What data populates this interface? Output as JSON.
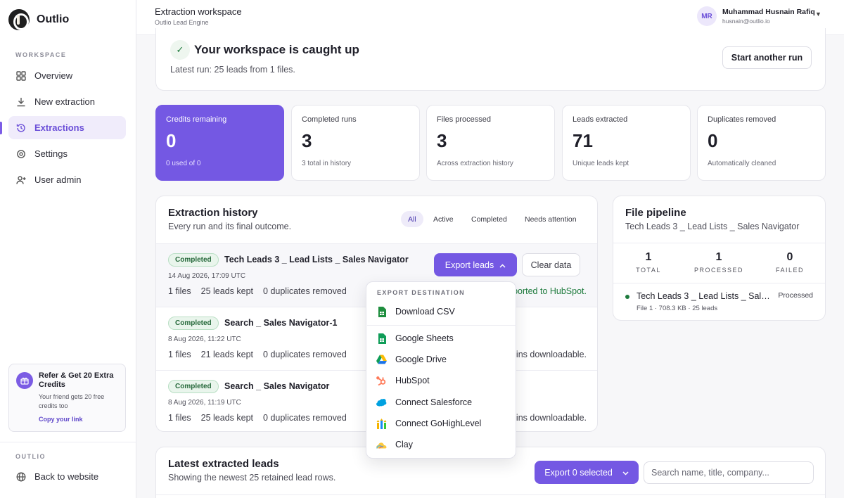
{
  "brand": {
    "name": "Outlio"
  },
  "sidebar": {
    "section_workspace": "WORKSPACE",
    "items": [
      {
        "label": "Overview",
        "icon": "grid-icon"
      },
      {
        "label": "New extraction",
        "icon": "download-icon"
      },
      {
        "label": "Extractions",
        "icon": "history-icon",
        "active": true
      },
      {
        "label": "Settings",
        "icon": "gear-icon"
      },
      {
        "label": "User admin",
        "icon": "user-plus-icon"
      }
    ],
    "refer": {
      "title": "Refer & Get 20 Extra Credits",
      "subtitle": "Your friend gets 20 free credits too",
      "link": "Copy your link"
    },
    "section_outlio": "OUTLIO",
    "back": "Back to website"
  },
  "header": {
    "title": "Extraction workspace",
    "subtitle": "Outlio Lead Engine",
    "user": {
      "initials": "MR",
      "name": "Muhammad Husnain Rafiq",
      "email": "husnain@outlio.io"
    }
  },
  "status": {
    "check": "✓",
    "title": "Your workspace is caught up",
    "subtitle": "Latest run: 25 leads from 1 files.",
    "button": "Start another run"
  },
  "stats": [
    {
      "label": "Credits remaining",
      "value": "0",
      "sub": "0 used of 0"
    },
    {
      "label": "Completed runs",
      "value": "3",
      "sub": "3 total in history"
    },
    {
      "label": "Files processed",
      "value": "3",
      "sub": "Across extraction history"
    },
    {
      "label": "Leads extracted",
      "value": "71",
      "sub": "Unique leads kept"
    },
    {
      "label": "Duplicates removed",
      "value": "0",
      "sub": "Automatically cleaned"
    }
  ],
  "history": {
    "title": "Extraction history",
    "subtitle": "Every run and its final outcome.",
    "filters": [
      "All",
      "Active",
      "Completed",
      "Needs attention"
    ],
    "runs": [
      {
        "badge": "Completed",
        "name": "Tech Leads 3 _ Lead Lists _ Sales Navigator",
        "date": "14 Aug 2026, 17:09 UTC",
        "files": "1 files",
        "leads": "25 leads kept",
        "dups": "0 duplicates removed",
        "status": "ported to HubSpot."
      },
      {
        "badge": "Completed",
        "name": "Search _ Sales Navigator-1",
        "date": "8 Aug 2026, 11:22 UTC",
        "files": "1 files",
        "leads": "21 leads kept",
        "dups": "0 duplicates removed",
        "status": "ins downloadable."
      },
      {
        "badge": "Completed",
        "name": "Search _ Sales Navigator",
        "date": "8 Aug 2026, 11:19 UTC",
        "files": "1 files",
        "leads": "25 leads kept",
        "dups": "0 duplicates removed",
        "status": "ins downloadable."
      }
    ],
    "export_label": "Export leads",
    "clear_label": "Clear data"
  },
  "dropdown": {
    "label": "EXPORT DESTINATION",
    "items": [
      {
        "label": "Download CSV",
        "icon": "csv-file-icon",
        "color": "#1e8e3e"
      },
      {
        "label": "Google Sheets",
        "icon": "google-sheets-icon",
        "color": "#1e8e3e"
      },
      {
        "label": "Google Drive",
        "icon": "google-drive-icon",
        "color": "#1a73e8"
      },
      {
        "label": "HubSpot",
        "icon": "hubspot-icon",
        "color": "#ff7a59"
      },
      {
        "label": "Connect Salesforce",
        "icon": "salesforce-icon",
        "color": "#00a1e0"
      },
      {
        "label": "Connect GoHighLevel",
        "icon": "gohighlevel-icon",
        "color": "#f5b400"
      },
      {
        "label": "Clay",
        "icon": "clay-icon",
        "color": "#4fb3e8"
      }
    ]
  },
  "pipeline": {
    "title": "File pipeline",
    "subtitle": "Tech Leads 3 _ Lead Lists _ Sales Navigator",
    "stats": [
      {
        "value": "1",
        "label": "TOTAL"
      },
      {
        "value": "1",
        "label": "PROCESSED"
      },
      {
        "value": "0",
        "label": "FAILED"
      }
    ],
    "file": {
      "name": "Tech Leads 3 _ Lead Lists _ Sales Navigator",
      "meta": "File 1 · 708.3 KB · 25 leads",
      "status": "Processed"
    }
  },
  "leads": {
    "title": "Latest extracted leads",
    "subtitle": "Showing the newest 25 retained lead rows.",
    "export_label": "Export 0 selected",
    "search_placeholder": "Search name, title, company..."
  },
  "colors": {
    "accent": "#7458e3",
    "success": "#1d7a3c"
  }
}
